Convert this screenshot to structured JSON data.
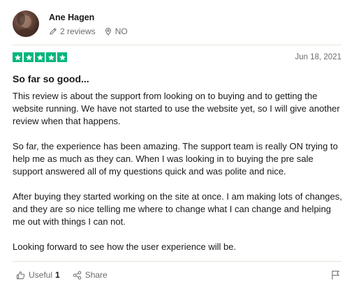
{
  "reviewer": {
    "name": "Ane Hagen",
    "reviews": "2 reviews",
    "country": "NO"
  },
  "review": {
    "rating": 5,
    "rating_max": 5,
    "date": "Jun 18, 2021",
    "title": "So far so good...",
    "paragraphs": [
      "This review is about the support from looking on to buying and to getting the website running. We have not started to use the website yet, so I will give another review when that happens.",
      "So far, the experience has been amazing. The support team is really ON trying to help me as much as they can. When I was looking in to buying the pre sale support answered all of my questions quick and was polite and nice.",
      "After buying they started working on the site at once. I am making lots of changes, and they are so nice telling me where to change what I can change and helping me out with things I can not.",
      "Looking forward to see how the user experience will be."
    ]
  },
  "actions": {
    "useful_label": "Useful",
    "useful_count": "1",
    "share_label": "Share"
  },
  "colors": {
    "star_green": "#00b67a",
    "muted_text": "#6b6b6b"
  },
  "icons": [
    "pencil-icon",
    "location-pin-icon",
    "star-icon",
    "thumbs-up-icon",
    "share-icon",
    "flag-icon"
  ]
}
